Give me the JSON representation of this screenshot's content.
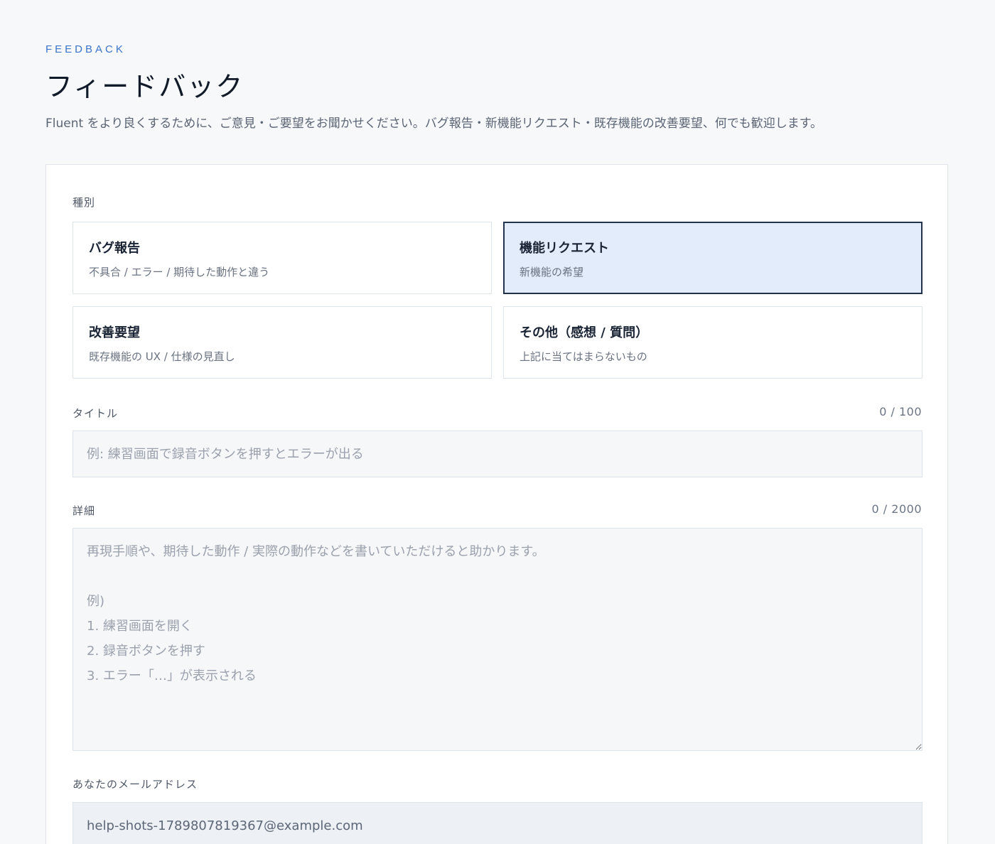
{
  "header": {
    "eyebrow": "FEEDBACK",
    "title": "フィードバック",
    "intro": "Fluent をより良くするために、ご意見・ご要望をお聞かせください。バグ報告・新機能リクエスト・既存機能の改善要望、何でも歓迎します。"
  },
  "form": {
    "type_label": "種別",
    "selected_type": "機能リクエスト",
    "types": [
      {
        "title": "バグ報告",
        "description": "不具合 / エラー / 期待した動作と違う",
        "selected": false
      },
      {
        "title": "機能リクエスト",
        "description": "新機能の希望",
        "selected": true
      },
      {
        "title": "改善要望",
        "description": "既存機能の UX / 仕様の見直し",
        "selected": false
      },
      {
        "title": "その他（感想 / 質問）",
        "description": "上記に当てはまらないもの",
        "selected": false
      }
    ],
    "title_field": {
      "label": "タイトル",
      "counter": "0 / 100",
      "value": "",
      "placeholder": "例: 練習画面で録音ボタンを押すとエラーが出る"
    },
    "detail_field": {
      "label": "詳細",
      "counter": "0 / 2000",
      "value": "",
      "placeholder": "再現手順や、期待した動作 / 実際の動作などを書いていただけると助かります。\n\n例)\n1. 練習画面を開く\n2. 録音ボタンを押す\n3. エラー「…」が表示される"
    },
    "email_field": {
      "label": "あなたのメールアドレス",
      "value": "help-shots-1789807819367@example.com"
    }
  },
  "colors": {
    "accent": "#3b74c9",
    "selected_bg": "#e3ecfb",
    "selected_border": "#22324a",
    "page_bg": "#f7f8fa"
  }
}
